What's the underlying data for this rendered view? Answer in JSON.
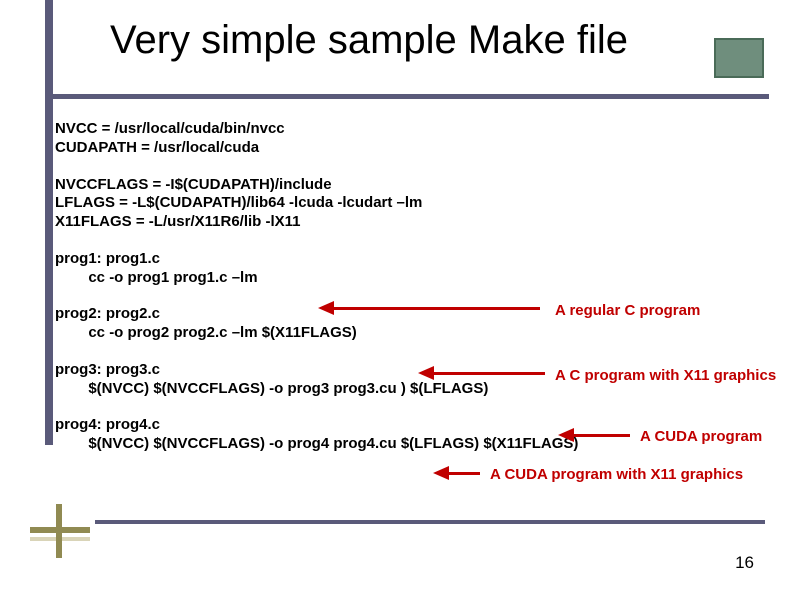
{
  "title": "Very simple sample Make file",
  "page_number": "16",
  "make": {
    "vars1": {
      "nvcc": "NVCC = /usr/local/cuda/bin/nvcc",
      "cudapath": "CUDAPATH = /usr/local/cuda"
    },
    "vars2": {
      "nvccflags": "NVCCFLAGS = -I$(CUDAPATH)/include",
      "lflags": "LFLAGS = -L$(CUDAPATH)/lib64 -lcuda -lcudart –lm",
      "x11flags": "X11FLAGS = -L/usr/X11R6/lib -lX11"
    },
    "targets": {
      "prog1": {
        "rule": "prog1: prog1.c",
        "cmd": "        cc -o prog1 prog1.c –lm"
      },
      "prog2": {
        "rule": "prog2: prog2.c",
        "cmd": "        cc -o prog2 prog2.c –lm $(X11FLAGS)"
      },
      "prog3": {
        "rule": "prog3: prog3.c",
        "cmd": "        $(NVCC) $(NVCCFLAGS) -o prog3 prog3.cu ) $(LFLAGS)"
      },
      "prog4": {
        "rule": "prog4: prog4.c",
        "cmd": "        $(NVCC) $(NVCCFLAGS) -o prog4 prog4.cu $(LFLAGS) $(X11FLAGS)"
      }
    }
  },
  "annotations": {
    "a1": "A regular C program",
    "a2": "A C program with X11 graphics",
    "a3": "A CUDA program",
    "a4": "A CUDA program with X11 graphics"
  }
}
